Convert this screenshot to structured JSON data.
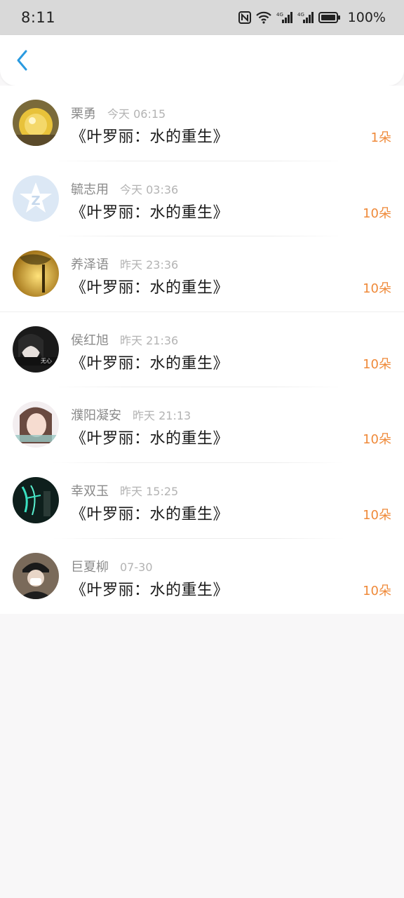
{
  "status_bar": {
    "time": "8:11",
    "nfc_icon": "nfc-icon",
    "wifi_icon": "wifi-icon",
    "signal1_label": "4G",
    "signal2_label": "4G",
    "battery": "100%"
  },
  "nav": {
    "back_icon": "chevron-left-icon",
    "accent": "#2a9ae0"
  },
  "records": [
    {
      "name": "栗勇",
      "time": "今天 06:15",
      "book": "《叶罗丽：水的重生》",
      "gift": "1朵"
    },
    {
      "name": "毓志用",
      "time": "今天 03:36",
      "book": "《叶罗丽：水的重生》",
      "gift": "10朵"
    },
    {
      "name": "养泽语",
      "time": "昨天 23:36",
      "book": "《叶罗丽：水的重生》",
      "gift": "10朵"
    },
    {
      "name": "侯红旭",
      "time": "昨天 21:36",
      "book": "《叶罗丽：水的重生》",
      "gift": "10朵",
      "avatar_text": "无心"
    },
    {
      "name": "濮阳凝安",
      "time": "昨天 21:13",
      "book": "《叶罗丽：水的重生》",
      "gift": "10朵"
    },
    {
      "name": "幸双玉",
      "time": "昨天 15:25",
      "book": "《叶罗丽：水的重生》",
      "gift": "10朵"
    },
    {
      "name": "巨夏柳",
      "time": "07-30",
      "book": "《叶罗丽：水的重生》",
      "gift": "10朵"
    }
  ],
  "colors": {
    "gift": "#ef8a3a",
    "name": "#8a8a8a",
    "time": "#b3b3b3"
  }
}
